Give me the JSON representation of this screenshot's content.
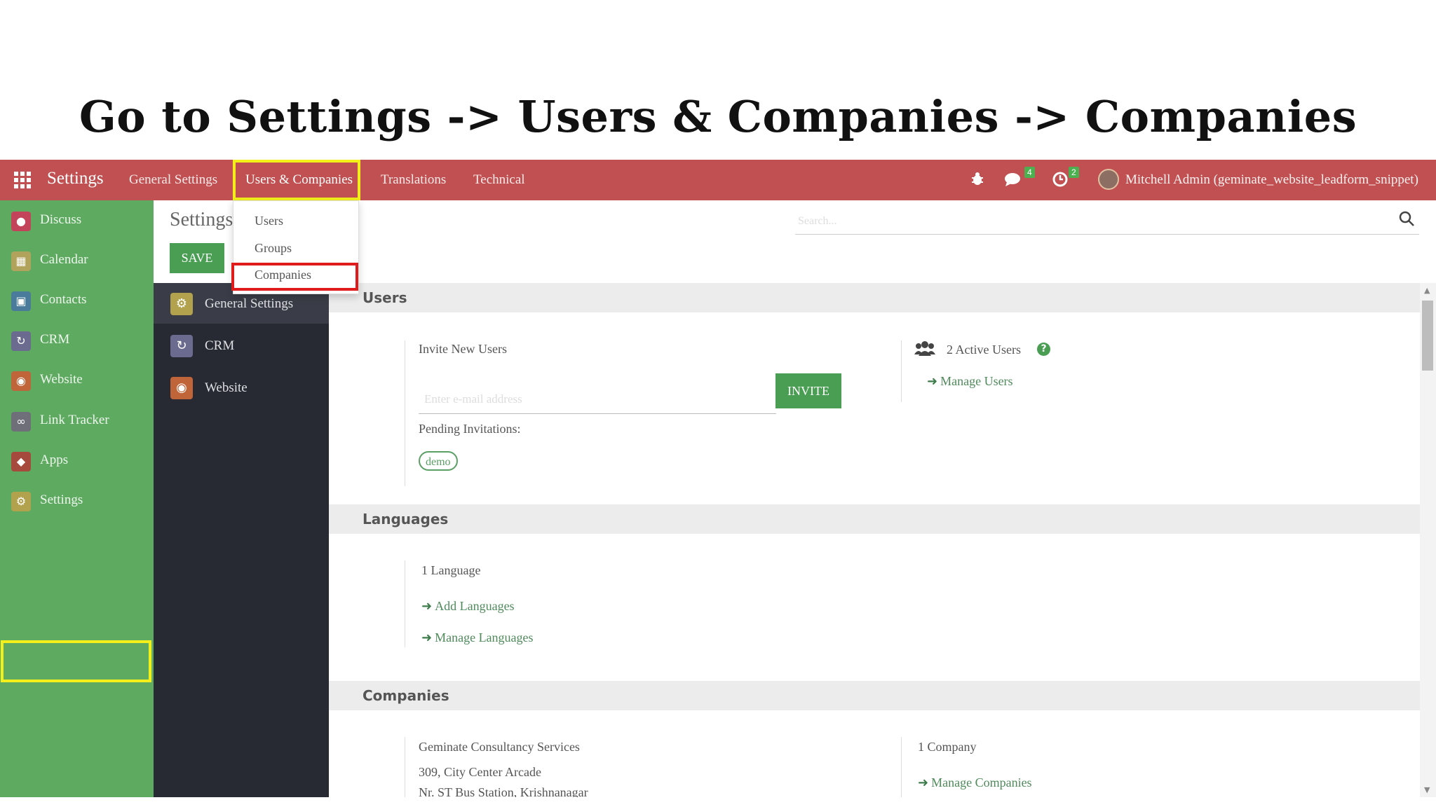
{
  "heading": "Go to Settings -> Users & Companies -> Companies",
  "navbar": {
    "brand": "Settings",
    "menu": [
      "General Settings",
      "Users & Companies",
      "Translations",
      "Technical"
    ],
    "chat_badge": "4",
    "activity_badge": "2",
    "user": "Mitchell Admin (geminate_website_leadform_snippet)"
  },
  "dropdown": {
    "items": [
      "Users",
      "Groups",
      "Companies"
    ]
  },
  "apps_sidebar": {
    "items": [
      {
        "label": "Discuss",
        "icon": "discuss-icon",
        "color": "#c2435a"
      },
      {
        "label": "Calendar",
        "icon": "calendar-icon",
        "color": "#b1a35c"
      },
      {
        "label": "Contacts",
        "icon": "contacts-icon",
        "color": "#4a7b9a"
      },
      {
        "label": "CRM",
        "icon": "crm-icon",
        "color": "#6a6b8f"
      },
      {
        "label": "Website",
        "icon": "website-icon",
        "color": "#c0643a"
      },
      {
        "label": "Link Tracker",
        "icon": "link-tracker-icon",
        "color": "#6f6f7a"
      },
      {
        "label": "Apps",
        "icon": "apps-icon",
        "color": "#a54a3c"
      },
      {
        "label": "Settings",
        "icon": "gear-icon",
        "color": "#b2a24e"
      }
    ]
  },
  "control": {
    "breadcrumb": "Settings",
    "save": "SAVE",
    "search_placeholder": "Search..."
  },
  "settings_sidebar": {
    "items": [
      {
        "label": "General Settings",
        "icon": "gear-icon",
        "color": "#b2a24e"
      },
      {
        "label": "CRM",
        "icon": "crm-icon",
        "color": "#6a6b8f"
      },
      {
        "label": "Website",
        "icon": "website-icon",
        "color": "#c0643a"
      }
    ]
  },
  "users": {
    "title": "Users",
    "invite_label": "Invite New Users",
    "email_placeholder": "Enter e-mail address",
    "invite_button": "INVITE",
    "pending_label": "Pending Invitations:",
    "pending_tag": "demo",
    "active_users": "2 Active Users",
    "manage_users": "Manage Users"
  },
  "languages": {
    "title": "Languages",
    "count": "1 Language",
    "add": "Add Languages",
    "manage": "Manage Languages"
  },
  "companies": {
    "title": "Companies",
    "name": "Geminate Consultancy Services",
    "address1": "309, City Center Arcade",
    "address2": "Nr. ST Bus Station, Krishnanagar",
    "count": "1 Company",
    "manage": "Manage Companies"
  }
}
